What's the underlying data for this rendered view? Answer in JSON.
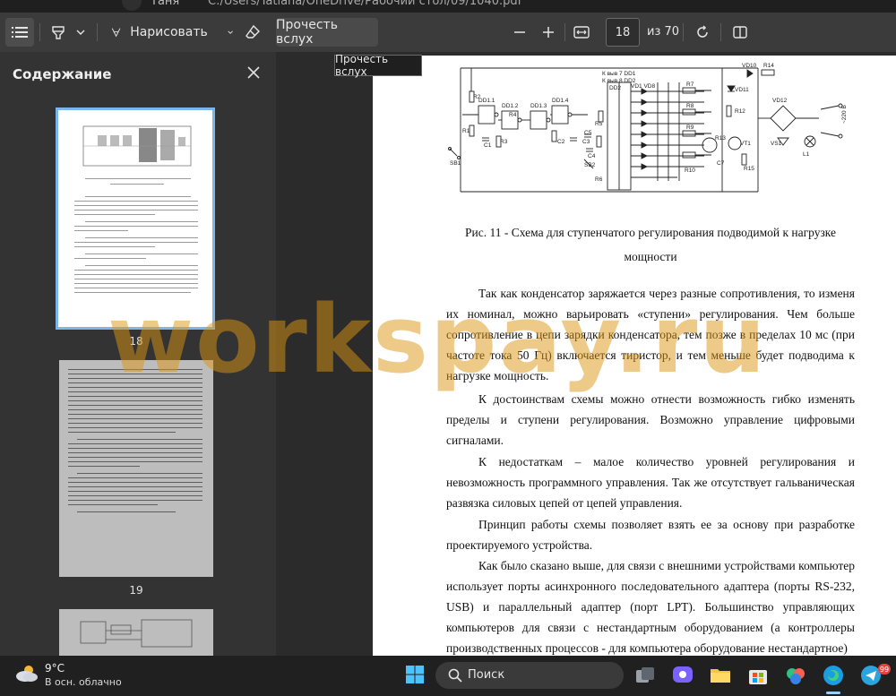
{
  "address": {
    "title_fragment": "Таня",
    "path": "C:/Users/Tatiana/OneDrive/Рабочий стол/09/1040.pdf"
  },
  "toolbar": {
    "draw_label": "Нарисовать",
    "read_aloud_label": "Прочесть вслух",
    "page_number": "18",
    "page_of": "из 70"
  },
  "tooltip": {
    "text": "Прочесть вслух"
  },
  "sidebar": {
    "title": "Содержание",
    "thumbs": [
      {
        "label": "18"
      },
      {
        "label": "19"
      }
    ]
  },
  "document": {
    "caption_line1": "Рис. 11 - Схема для ступенчатого регулирования подводимой к нагрузке",
    "caption_line2": "мощности",
    "paragraphs": [
      "Так как конденсатор заряжается через разные сопротивления, то изменя их номинал, можно варьировать «ступени» регулирования. Чем больше сопротивление в цепи зарядки конденсатора, тем позже в пределах 10 мс (при частоте тока 50 Гц) включается тиристор, и тем меньше будет подводима к нагрузке мощность.",
      "К достоинствам схемы можно отнести возможность гибко изменять пределы и ступени регулирования. Возможно управление цифровыми сигналами.",
      "К недостаткам – малое количество уровней регулирования и невозможность программного управления. Так же отсутствует гальваническая развязка силовых цепей от цепей управления.",
      "Принцип работы схемы позволяет взять ее за основу при разработке проектируемого устройства.",
      "Как было сказано выше, для связи с внешними устройствами компьютер использует порты асинхронного последовательного адаптера (порты RS-232, USB) и параллельный адаптер (порт LPT). Большинство управляющих компьютеров для связи с нестандартным оборудованием (а контроллеры производственных процессов - для компьютера оборудование нестандартное)"
    ],
    "circuit_labels": {
      "vd10": "VD10",
      "r14": "R14",
      "kvse7": "К выв 7 DD1",
      "kvse8": "К выв 8 DD2",
      "dd2": "DD2",
      "vd1vd8": "VD1 VD8",
      "r7": "R7",
      "dd11": "DD1.1",
      "dd12": "DD1.2",
      "dd13": "DD1.3",
      "dd14": "DD1.4",
      "r1": "R1",
      "r2": "R2",
      "r3": "R3",
      "r4": "R4",
      "r5": "R5",
      "r6": "R6",
      "r8": "R8",
      "r9": "R9",
      "r10": "R10",
      "r12": "R12",
      "r13": "R13",
      "r15": "R15",
      "c1": "C1",
      "c2": "C2",
      "c3": "C3",
      "c4": "C4",
      "c5": "C5",
      "c7": "C7",
      "sb1": "SB1",
      "sb2": "SB2",
      "vt1": "VT1",
      "vd11": "VD11",
      "vd12": "VD12",
      "vs1": "VS1",
      "l1": "L1",
      "v220": "~220 В"
    }
  },
  "watermark": "workspay.ru",
  "taskbar": {
    "weather_temp": "9°C",
    "weather_desc": "В осн. облачно",
    "search_text": "Поиск",
    "badge_count": "99"
  }
}
